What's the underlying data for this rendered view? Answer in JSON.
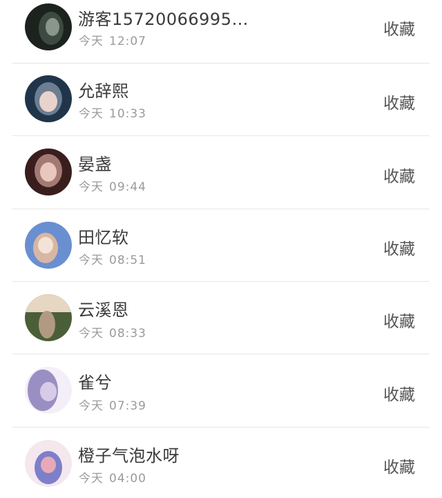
{
  "entries": [
    {
      "name": "游客15720066995…",
      "date": "今天",
      "time": "12:07",
      "action": "收藏",
      "avatar_colors": [
        "#1c231f",
        "#3c4a42",
        "#8a958c"
      ]
    },
    {
      "name": "允辞熙",
      "date": "今天",
      "time": "10:33",
      "action": "收藏",
      "avatar_colors": [
        "#20354a",
        "#6d7d92",
        "#e8d3cc"
      ]
    },
    {
      "name": "晏盏",
      "date": "今天",
      "time": "09:44",
      "action": "收藏",
      "avatar_colors": [
        "#3a1e1e",
        "#a37a72",
        "#e9c7bf"
      ]
    },
    {
      "name": "田忆软",
      "date": "今天",
      "time": "08:51",
      "action": "收藏",
      "avatar_colors": [
        "#6a8fd0",
        "#d9b6a3",
        "#f3e3d6"
      ]
    },
    {
      "name": "云溪恩",
      "date": "今天",
      "time": "08:33",
      "action": "收藏",
      "avatar_colors": [
        "#4a5f38",
        "#b29a82",
        "#e6d6c2"
      ]
    },
    {
      "name": "雀兮",
      "date": "今天",
      "time": "07:39",
      "action": "收藏",
      "avatar_colors": [
        "#9a8fc2",
        "#d8cbe8",
        "#f4eef8"
      ]
    },
    {
      "name": "橙子气泡水呀",
      "date": "今天",
      "time": "04:00",
      "action": "收藏",
      "avatar_colors": [
        "#7d7fc9",
        "#e7a9b8",
        "#f4e7ee"
      ]
    }
  ]
}
